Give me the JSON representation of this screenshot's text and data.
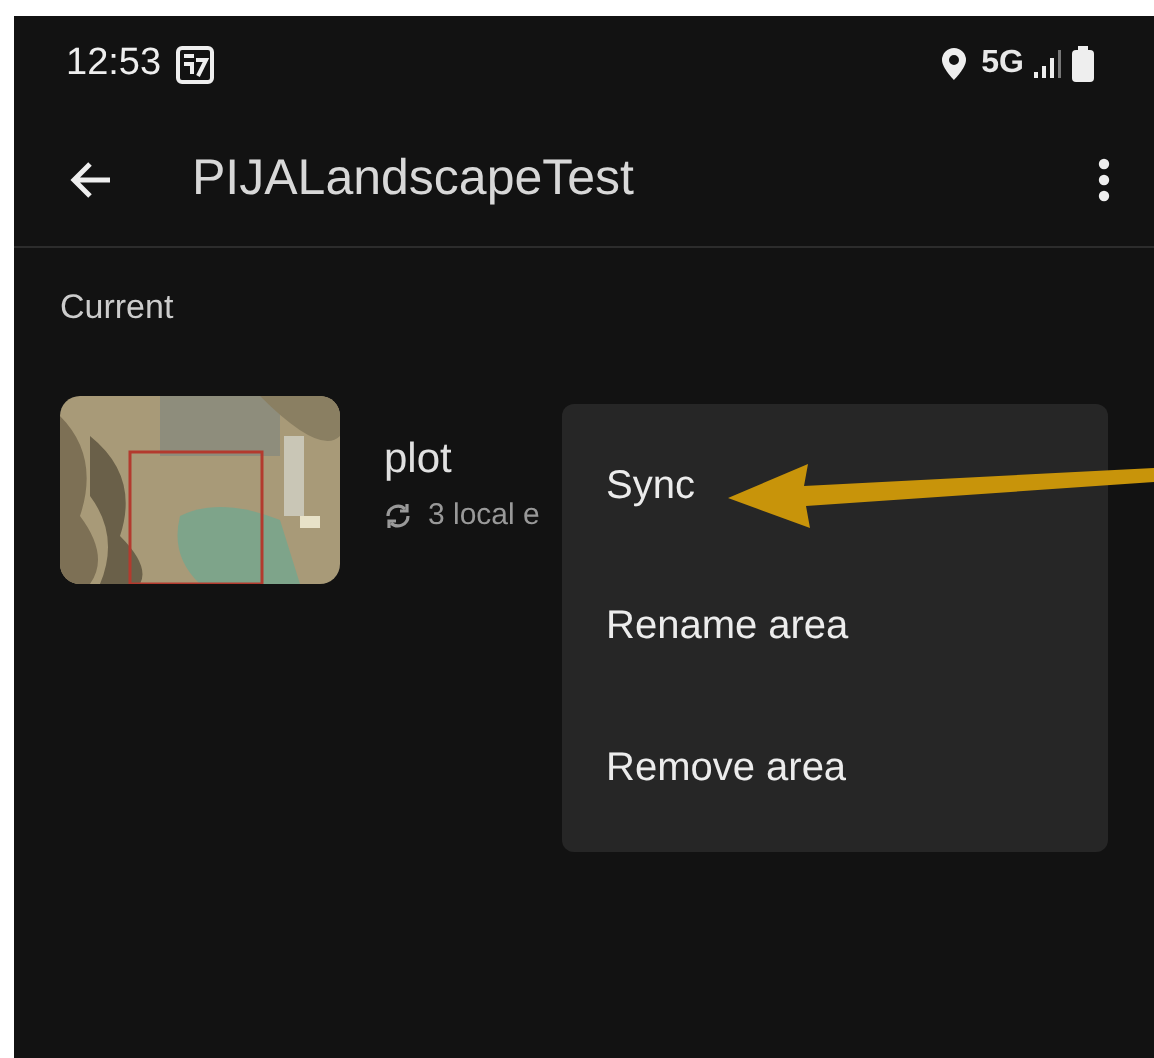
{
  "status_bar": {
    "time": "12:53",
    "network": "5G"
  },
  "toolbar": {
    "title": "PIJALandscapeTest"
  },
  "section": {
    "title": "Current"
  },
  "areas": [
    {
      "name": "plot",
      "status": "3 local e"
    }
  ],
  "menu": {
    "items": [
      {
        "label": "Sync"
      },
      {
        "label": "Rename area"
      },
      {
        "label": "Remove area"
      }
    ]
  },
  "annotation": {
    "kind": "arrow",
    "color": "#c8940a"
  }
}
